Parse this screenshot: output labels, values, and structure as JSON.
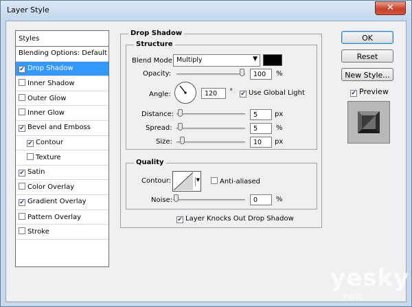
{
  "window": {
    "title": "Layer Style",
    "close_label": "✕"
  },
  "styles_panel": {
    "header": "Styles",
    "items": [
      {
        "label": "Blending Options: Default",
        "has_checkbox": false,
        "checked": false,
        "selected": false,
        "indent": false
      },
      {
        "label": "Drop Shadow",
        "has_checkbox": true,
        "checked": true,
        "selected": true,
        "indent": false
      },
      {
        "label": "Inner Shadow",
        "has_checkbox": true,
        "checked": false,
        "selected": false,
        "indent": false
      },
      {
        "label": "Outer Glow",
        "has_checkbox": true,
        "checked": false,
        "selected": false,
        "indent": false
      },
      {
        "label": "Inner Glow",
        "has_checkbox": true,
        "checked": false,
        "selected": false,
        "indent": false
      },
      {
        "label": "Bevel and Emboss",
        "has_checkbox": true,
        "checked": true,
        "selected": false,
        "indent": false
      },
      {
        "label": "Contour",
        "has_checkbox": true,
        "checked": true,
        "selected": false,
        "indent": true
      },
      {
        "label": "Texture",
        "has_checkbox": true,
        "checked": false,
        "selected": false,
        "indent": true
      },
      {
        "label": "Satin",
        "has_checkbox": true,
        "checked": true,
        "selected": false,
        "indent": false
      },
      {
        "label": "Color Overlay",
        "has_checkbox": true,
        "checked": false,
        "selected": false,
        "indent": false
      },
      {
        "label": "Gradient Overlay",
        "has_checkbox": true,
        "checked": true,
        "selected": false,
        "indent": false
      },
      {
        "label": "Pattern Overlay",
        "has_checkbox": true,
        "checked": false,
        "selected": false,
        "indent": false
      },
      {
        "label": "Stroke",
        "has_checkbox": true,
        "checked": false,
        "selected": false,
        "indent": false
      }
    ]
  },
  "drop_shadow": {
    "title": "Drop Shadow",
    "structure": {
      "title": "Structure",
      "blend_mode_label": "Blend Mode:",
      "blend_mode_value": "Multiply",
      "shadow_color": "#000000",
      "opacity_label": "Opacity:",
      "opacity_value": "100",
      "opacity_unit": "%",
      "angle_label": "Angle:",
      "angle_value": "120",
      "angle_unit": "°",
      "global_light_label": "Use Global Light",
      "global_light_checked": true,
      "distance_label": "Distance:",
      "distance_value": "5",
      "distance_unit": "px",
      "spread_label": "Spread:",
      "spread_value": "5",
      "spread_unit": "%",
      "size_label": "Size:",
      "size_value": "10",
      "size_unit": "px"
    },
    "quality": {
      "title": "Quality",
      "contour_label": "Contour:",
      "anti_aliased_label": "Anti-aliased",
      "anti_aliased_checked": false,
      "noise_label": "Noise:",
      "noise_value": "0",
      "noise_unit": "%"
    },
    "knockout_label": "Layer Knocks Out Drop Shadow",
    "knockout_checked": true
  },
  "buttons": {
    "ok": "OK",
    "reset": "Reset",
    "new_style": "New Style...",
    "preview_label": "Preview",
    "preview_checked": true
  },
  "watermark": {
    "brand": "yesky",
    "sub": "天极网"
  }
}
